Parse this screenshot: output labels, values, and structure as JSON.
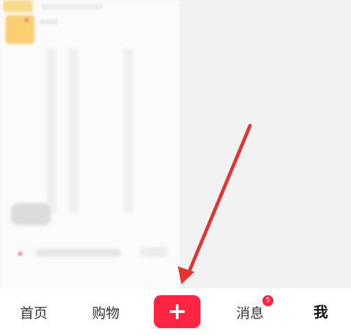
{
  "tabbar": {
    "home_label": "首页",
    "shop_label": "购物",
    "messages_label": "消息",
    "messages_badge": "5",
    "me_label": "我",
    "create_icon": "plus-icon"
  },
  "colors": {
    "accent": "#ff2442",
    "annotation_arrow": "#e53232",
    "tabbar_bg": "#ffffff",
    "tab_text": "#333333"
  }
}
